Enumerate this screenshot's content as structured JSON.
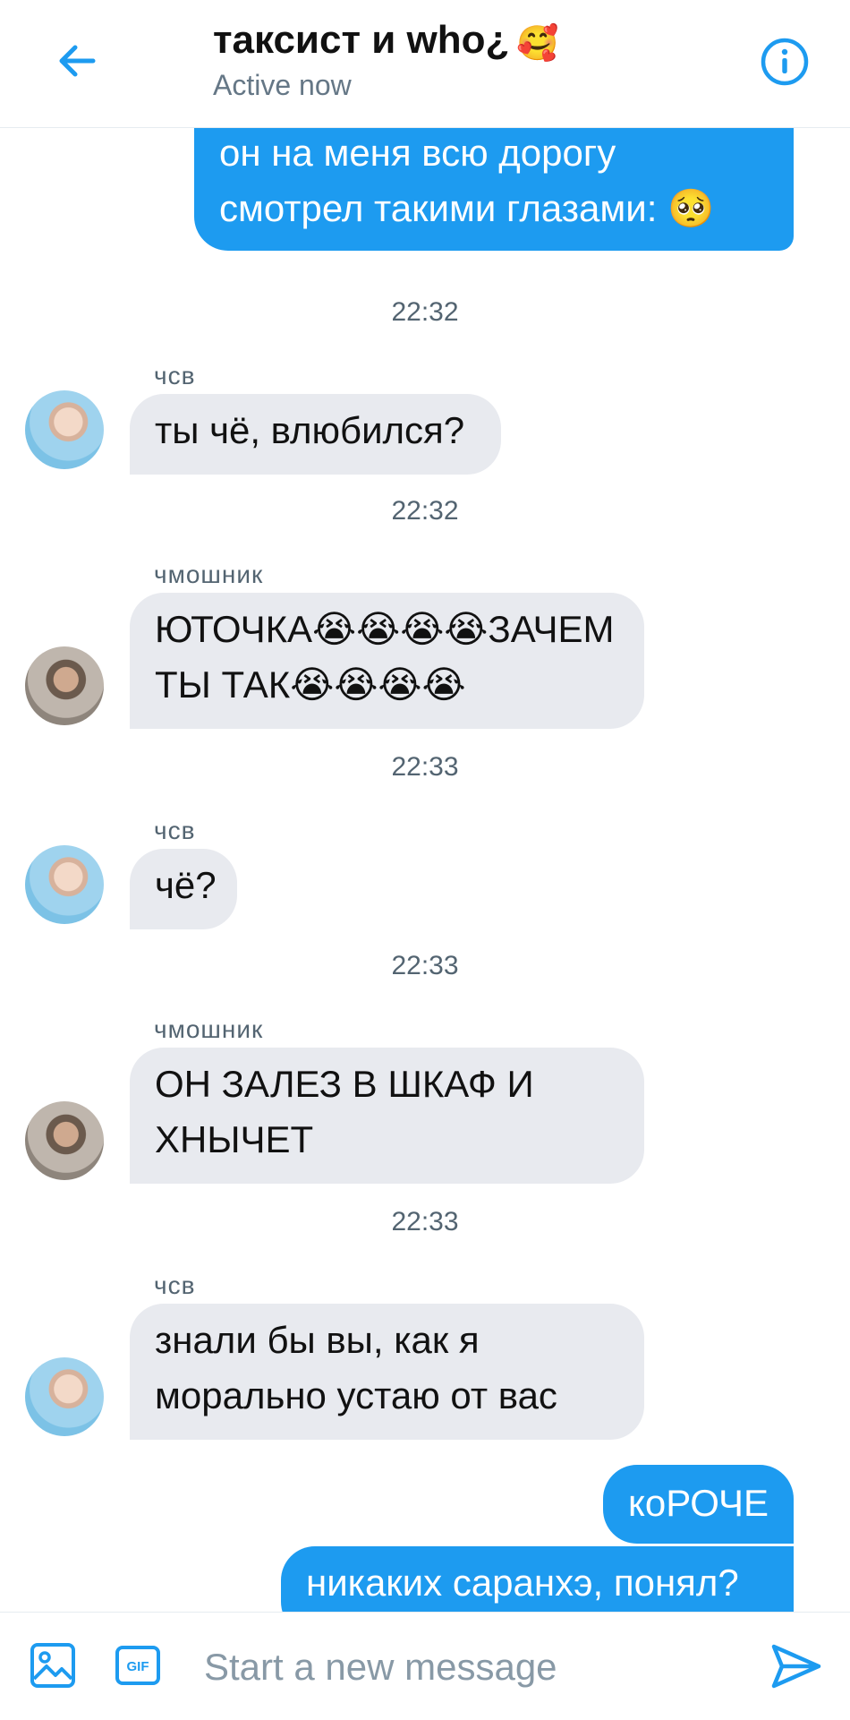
{
  "header": {
    "title": "таксист и who¿",
    "title_emoji": "🥰",
    "status": "Active now"
  },
  "messages": [
    {
      "type": "me",
      "text_lines": [
        "он на меня всю дорогу",
        "смотрел такими глазами: 🥺"
      ]
    },
    {
      "type": "time",
      "text": "22:32"
    },
    {
      "type": "them",
      "sender": "чсв",
      "text": "ты чё, влюбился?",
      "avatar": "blue"
    },
    {
      "type": "time",
      "text": "22:32"
    },
    {
      "type": "them",
      "sender": "чмошник",
      "text_lines": [
        "ЮТОЧКА😭😭😭😭ЗАЧЕМ",
        "ТЫ ТАК😭😭😭😭"
      ],
      "avatar": "grey"
    },
    {
      "type": "time",
      "text": "22:33"
    },
    {
      "type": "them",
      "sender": "чсв",
      "text": "чё?",
      "avatar": "blue"
    },
    {
      "type": "time",
      "text": "22:33"
    },
    {
      "type": "them",
      "sender": "чмошник",
      "text_lines": [
        "ОН ЗАЛЕЗ В ШКАФ И",
        "ХНЫЧЕТ"
      ],
      "avatar": "grey"
    },
    {
      "type": "time",
      "text": "22:33"
    },
    {
      "type": "them",
      "sender": "чсв",
      "text_lines": [
        "знали бы вы, как я",
        "морально устаю от вас"
      ],
      "avatar": "blue"
    },
    {
      "type": "me",
      "text": "коРОЧЕ"
    },
    {
      "type": "me",
      "text": "никаких саранхэ, понял?"
    }
  ],
  "composer": {
    "placeholder": "Start a new message",
    "gif_label": "GIF"
  },
  "colors": {
    "accent": "#1d9bf0",
    "bubble_them": "#e8eaef",
    "secondary_text": "#536471"
  }
}
